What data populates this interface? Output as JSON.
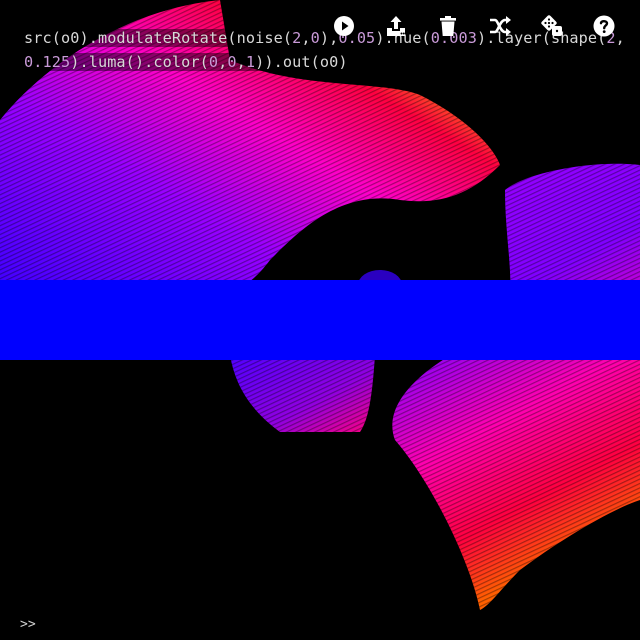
{
  "editor": {
    "code_tokens": [
      {
        "t": "src(o0).modulateRotate(noise(",
        "k": "fn"
      },
      {
        "t": "2",
        "k": "num"
      },
      {
        "t": ",",
        "k": "fn"
      },
      {
        "t": "0",
        "k": "num"
      },
      {
        "t": "),",
        "k": "fn"
      },
      {
        "t": "0.05",
        "k": "num"
      },
      {
        "t": ").hue(",
        "k": "fn"
      },
      {
        "t": "0.003",
        "k": "num"
      },
      {
        "t": ").layer(shape(",
        "k": "fn"
      },
      {
        "t": "2",
        "k": "num"
      },
      {
        "t": ",",
        "k": "fn"
      },
      {
        "t": "0.125",
        "k": "num"
      },
      {
        "t": ").luma().color(",
        "k": "fn"
      },
      {
        "t": "0",
        "k": "num"
      },
      {
        "t": ",",
        "k": "fn"
      },
      {
        "t": "0",
        "k": "num"
      },
      {
        "t": ",",
        "k": "fn"
      },
      {
        "t": "1",
        "k": "num"
      },
      {
        "t": ")).out(o0)",
        "k": "fn"
      }
    ]
  },
  "toolbar": {
    "buttons": [
      {
        "icon": "play-icon",
        "name": "run-button"
      },
      {
        "icon": "upload-icon",
        "name": "share-button"
      },
      {
        "icon": "trash-icon",
        "name": "clear-button"
      },
      {
        "icon": "shuffle-icon",
        "name": "shuffle-button"
      },
      {
        "icon": "dice-icon",
        "name": "random-button"
      },
      {
        "icon": "help-icon",
        "name": "help-button"
      }
    ]
  },
  "console": {
    "prompt": ">>"
  },
  "colors": {
    "background": "#000000",
    "code_text": "#d8d8d8",
    "code_number": "#c99ad8",
    "band_blue": "#0000ff"
  }
}
